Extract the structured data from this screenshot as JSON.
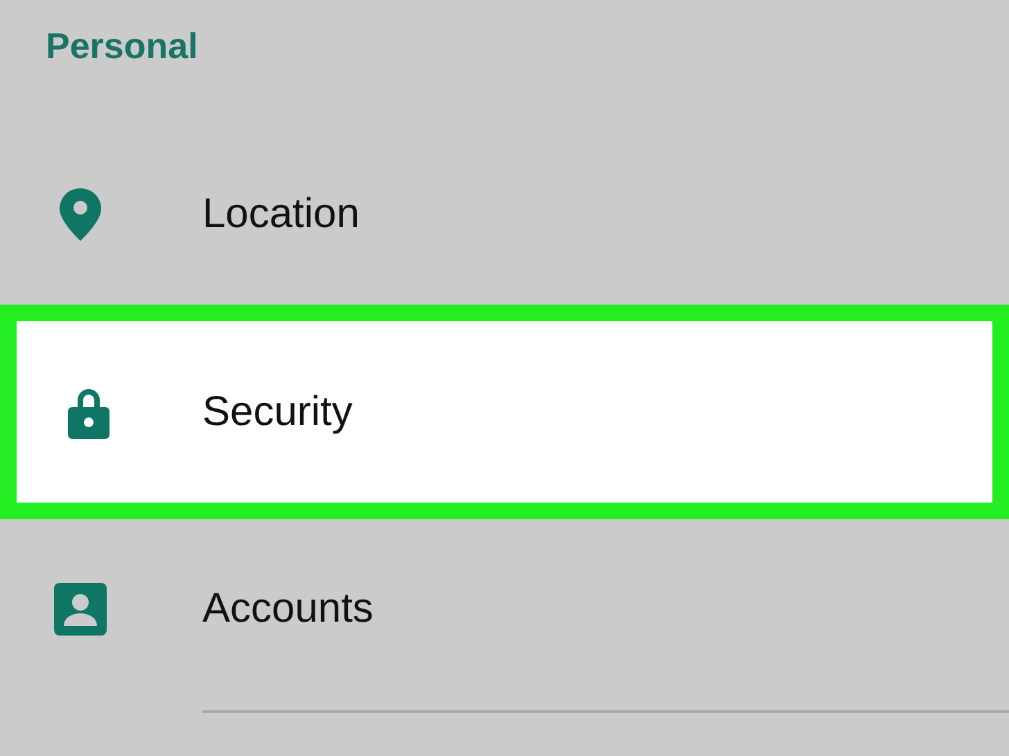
{
  "section": {
    "title": "Personal"
  },
  "items": [
    {
      "label": "Location",
      "kind": "location",
      "selected": false
    },
    {
      "label": "Security",
      "kind": "security",
      "selected": true
    },
    {
      "label": "Accounts",
      "kind": "accounts",
      "selected": false
    }
  ]
}
